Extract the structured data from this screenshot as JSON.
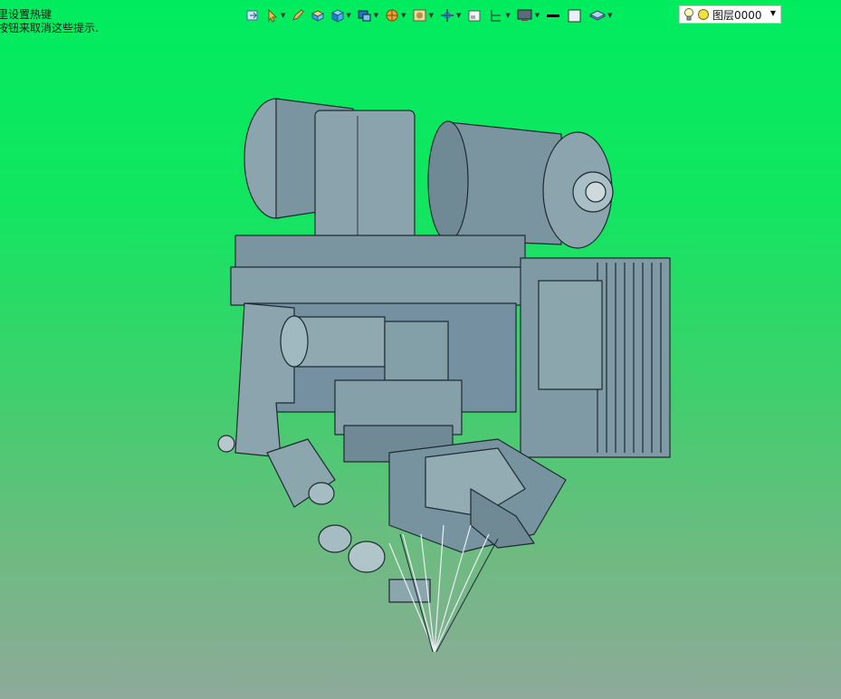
{
  "hint": {
    "line1": "里设置热键",
    "line2": "按钮来取消这些提示."
  },
  "toolbar": {
    "icons": [
      "open-icon",
      "pointer-icon",
      "pencil-icon",
      "box-icon",
      "cube-icon",
      "view-cube-icon",
      "render-icon",
      "material-icon",
      "pan-icon",
      "window-icon",
      "section-icon",
      "display-icon",
      "line-icon",
      "color-icon",
      "layer-stack-icon",
      "bulb-icon",
      "layer-dot-icon"
    ]
  },
  "layer": {
    "value": "图层0000"
  },
  "colors": {
    "model_fill": "#7f9aa4",
    "model_stroke": "#1d2b30",
    "bg_top": "#00ec5e",
    "bg_bottom": "#8ea99a"
  }
}
